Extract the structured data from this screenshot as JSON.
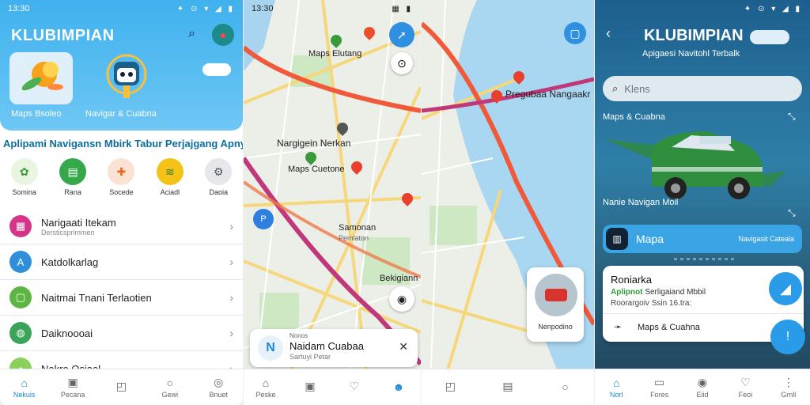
{
  "panel1": {
    "time": "13:30",
    "app_title": "KLUBIMPIAN",
    "card_captions": [
      "Maps Bsoleo",
      "Navigar & Cuabna"
    ],
    "tagline": "Aplipami Navigansn Mbirk Tabur Perjajgang Apny",
    "categories": [
      "Somina",
      "Rana",
      "Socede",
      "Aciadl",
      "Daoia"
    ],
    "list": [
      {
        "title": "Narigaati Itekam",
        "subtitle": "Dersticsprimmen"
      },
      {
        "title": "Katdolkarlag",
        "subtitle": ""
      },
      {
        "title": "Naitmai Tnani Terlaotien",
        "subtitle": ""
      },
      {
        "title": "Daiknoooai",
        "subtitle": ""
      },
      {
        "title": "Nakro Osiael",
        "subtitle": ""
      }
    ],
    "nav": [
      "Nekuis",
      "Pecana",
      "",
      "Gewi",
      "Bnuet"
    ]
  },
  "panel2": {
    "time": "13:30",
    "labels": [
      "Maps Elutang",
      "Nargigein Nerkan",
      "Maps Cuetone",
      "Samonan",
      "Pemlaton",
      "Bekigiann"
    ],
    "sheet_title": "Naidam Cuabaa",
    "sheet_sub": "Sartuyi Petar",
    "sheet_over": "Nonos",
    "nav": [
      "Peske",
      "",
      "",
      ""
    ]
  },
  "panel3": {
    "labels": [
      "Pregubaa Nangaakr"
    ],
    "photo_caption": "Nenpodino",
    "nav": [
      "",
      "",
      ""
    ]
  },
  "panel4": {
    "app_title": "KLUBIMPIAN",
    "subtitle": "Apigaesi Navitohl Terbalk",
    "search_placeholder": "Klens",
    "section1": "Maps & Cuabna",
    "section2": "Nanie Navigan Moil",
    "banner_title": "Mapa",
    "banner_right": "Navigasit Cateala",
    "card_title": "Roniarka",
    "card_green": "Aplipnot",
    "card_line1": "Serligaiand Mbbil",
    "card_line2": "Roorargoiv Ssin 16.tra:",
    "card_action": "Maps & Cuahna",
    "nav": [
      "Norl",
      "Fores",
      "Eiid",
      "Feoi",
      "Grnll"
    ]
  }
}
